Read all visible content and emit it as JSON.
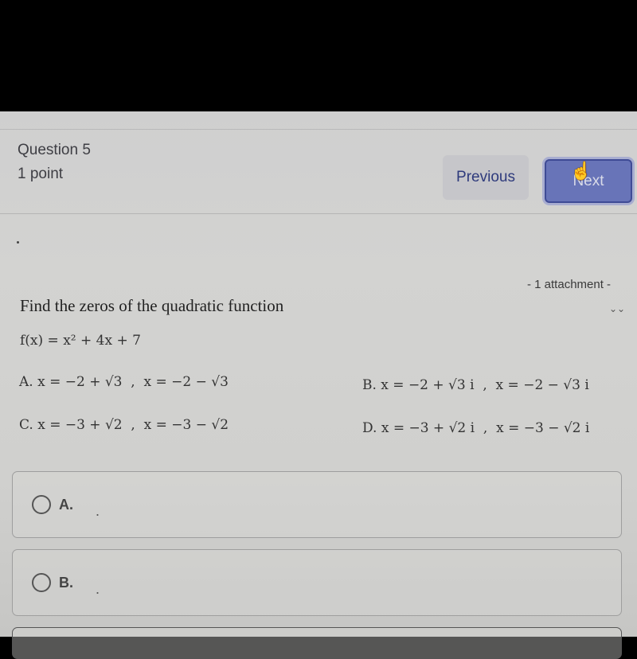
{
  "question": {
    "title": "Question 5",
    "points": "1 point"
  },
  "nav": {
    "previous_label": "Previous",
    "next_label": "Next",
    "cursor_icon": "hand-pointer-icon"
  },
  "attachment": {
    "label": "- 1 attachment  -",
    "toggle_icon": "double-chevron-down-icon"
  },
  "body": {
    "dot": ".",
    "prompt": "Find the zeros of the quadratic function",
    "function": "f(x) = x² + 4x + 7",
    "choices": [
      {
        "letter": "A",
        "text": "A. x = −2 + √3  ,  x = −2 − √3"
      },
      {
        "letter": "B",
        "text": "B. x = −2 + √3 i  ,  x = −2 − √3 i"
      },
      {
        "letter": "C",
        "text": "C. x = −3 + √2  ,  x = −3 − √2"
      },
      {
        "letter": "D",
        "text": "D. x = −3 + √2 i  ,  x = −3 − √2 i"
      }
    ]
  },
  "answer_options": [
    {
      "label": "A.",
      "value": "."
    },
    {
      "label": "B.",
      "value": "."
    }
  ]
}
